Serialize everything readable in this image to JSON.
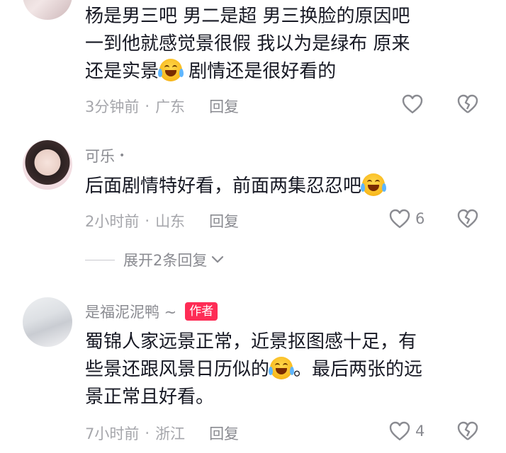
{
  "comments": [
    {
      "author": "",
      "text_lines": [
        "杨是男三吧  男二是超  男三换脸的原因吧",
        "一到他就感觉景很假  我以为是绿布  原来",
        "还是实景"
      ],
      "text_after_emoji": " 剧情还是很好看的",
      "time": "3分钟前",
      "location": "广东",
      "reply_label": "回复",
      "likes": ""
    },
    {
      "author": "可乐",
      "online_dot": "•",
      "text": "后面剧情特好看，前面两集忍忍吧",
      "time": "2小时前",
      "location": "山东",
      "reply_label": "回复",
      "likes": "6"
    },
    {
      "author": "是福泥泥鸭 ~",
      "author_tag": "作者",
      "text_line1": "蜀锦人家远景正常，近景抠图感十足，有",
      "text_line2_before": "些景还跟风景日历似的",
      "text_line2_after": "。最后两张的远",
      "text_line3": "景正常且好看。",
      "time": "7小时前",
      "location": "浙江",
      "reply_label": "回复",
      "likes": "4"
    }
  ],
  "expand_replies": "展开2条回复",
  "separator": "·",
  "icons": {
    "like": "heart-outline-icon",
    "dislike": "broken-heart-icon",
    "expand": "chevron-down-icon",
    "emoji": "laughing-crying-emoji-icon"
  },
  "colors": {
    "author_tag": "#fe2c55",
    "meta": "#a5a6ab",
    "text": "#161823"
  }
}
